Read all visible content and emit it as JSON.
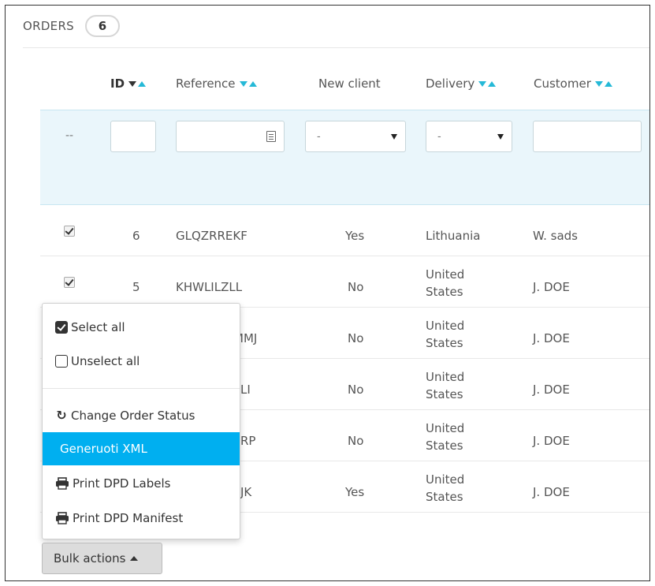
{
  "panel": {
    "title": "ORDERS",
    "count": "6"
  },
  "columns": {
    "id": "ID",
    "reference": "Reference",
    "new_client": "New client",
    "delivery": "Delivery",
    "customer": "Customer"
  },
  "filters": {
    "no_filter": "--",
    "new_client_value": "-",
    "delivery_value": "-"
  },
  "rows": [
    {
      "checked": true,
      "id": "6",
      "reference": "GLQZRREKF",
      "new_client": "Yes",
      "delivery_line1": "Lithuania",
      "delivery_line2": "",
      "customer": "W. sads"
    },
    {
      "checked": true,
      "id": "5",
      "reference": "KHWLILZLL",
      "new_client": "No",
      "delivery_line1": "United",
      "delivery_line2": "States",
      "customer": "J. DOE"
    },
    {
      "checked": false,
      "id": "",
      "reference": "MMJ",
      "new_client": "No",
      "delivery_line1": "United",
      "delivery_line2": "States",
      "customer": "J. DOE"
    },
    {
      "checked": false,
      "id": "",
      "reference": "LI",
      "new_client": "No",
      "delivery_line1": "United",
      "delivery_line2": "States",
      "customer": "J. DOE"
    },
    {
      "checked": false,
      "id": "",
      "reference": "RP",
      "new_client": "No",
      "delivery_line1": "United",
      "delivery_line2": "States",
      "customer": "J. DOE"
    },
    {
      "checked": false,
      "id": "",
      "reference": "JK",
      "new_client": "Yes",
      "delivery_line1": "United",
      "delivery_line2": "States",
      "customer": "J. DOE"
    }
  ],
  "bulk_menu": {
    "select_all": "Select all",
    "unselect_all": "Unselect all",
    "change_status": "Change Order Status",
    "generate_xml": "Generuoti XML",
    "print_labels": "Print DPD Labels",
    "print_manifest": "Print DPD Manifest"
  },
  "bulk_button": {
    "label": "Bulk actions"
  },
  "colors": {
    "accent": "#25b9d7",
    "active_item": "#00aff0",
    "filter_bg": "#eaf6fb"
  }
}
